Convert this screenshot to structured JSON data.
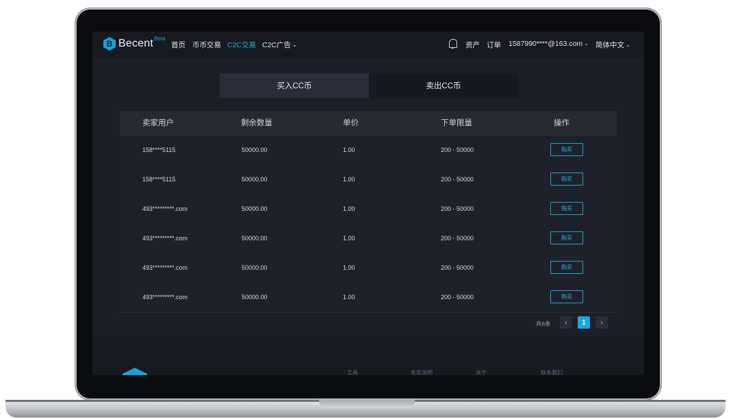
{
  "nav": {
    "logo_mark": "B",
    "logo_text": "Becent",
    "logo_beta": "Beta",
    "links": [
      "首页",
      "币币交易",
      "C2C交易",
      "C2C广告"
    ],
    "right": {
      "assets": "资产",
      "orders": "订单",
      "account": "1587990****@163.com",
      "language": "简体中文"
    }
  },
  "tabs": {
    "buy": "买入CC币",
    "sell": "卖出CC币"
  },
  "table": {
    "headers": [
      "卖家用户",
      "剩余数量",
      "单价",
      "下单限量",
      "操作"
    ],
    "rows": [
      {
        "user": "158****5115",
        "remaining": "50000.00",
        "price": "1.00",
        "limit": "200 - 50000",
        "action": "购买"
      },
      {
        "user": "158****5115",
        "remaining": "50000.00",
        "price": "1.00",
        "limit": "200 - 50000",
        "action": "购买"
      },
      {
        "user": "493*********.com",
        "remaining": "50000.00",
        "price": "1.00",
        "limit": "200 - 50000",
        "action": "购买"
      },
      {
        "user": "493*********.com",
        "remaining": "50000.00",
        "price": "1.00",
        "limit": "200 - 50000",
        "action": "购买"
      },
      {
        "user": "493*********.com",
        "remaining": "50000.00",
        "price": "1.00",
        "limit": "200 - 50000",
        "action": "购买"
      },
      {
        "user": "493*********.com",
        "remaining": "50000.00",
        "price": "1.00",
        "limit": "200 - 50000",
        "action": "购买"
      }
    ]
  },
  "pagination": {
    "total": "共6条",
    "prev": "‹",
    "current": "1",
    "next": "›"
  },
  "footer": {
    "links": [
      "工具",
      "条款说明",
      "关于",
      "联系我们"
    ]
  },
  "colors": {
    "accent": "#1ea5dc",
    "background": "#1c1f27",
    "nav_bg": "#171a21"
  }
}
